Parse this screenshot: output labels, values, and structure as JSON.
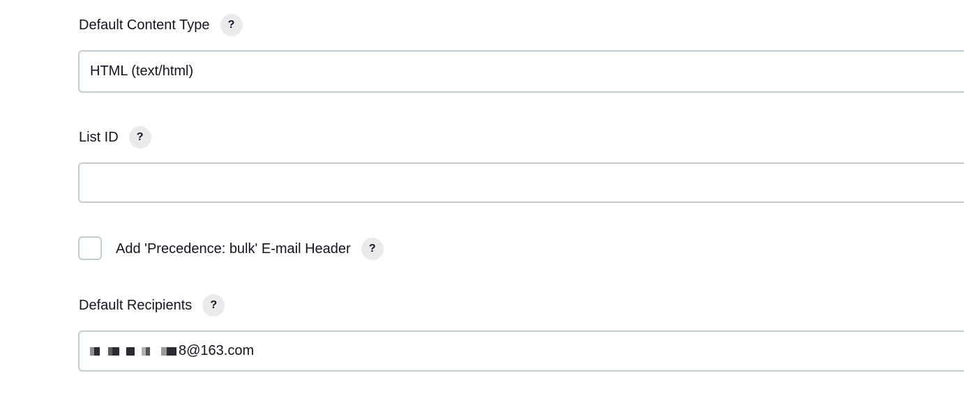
{
  "fields": {
    "content_type": {
      "label": "Default Content Type",
      "value": "HTML (text/html)"
    },
    "list_id": {
      "label": "List ID",
      "value": ""
    },
    "precedence": {
      "label": "Add 'Precedence: bulk' E-mail Header",
      "checked": false
    },
    "recipients": {
      "label": "Default Recipients",
      "value_visible_suffix": "8@163.com"
    }
  },
  "help_symbol": "?"
}
